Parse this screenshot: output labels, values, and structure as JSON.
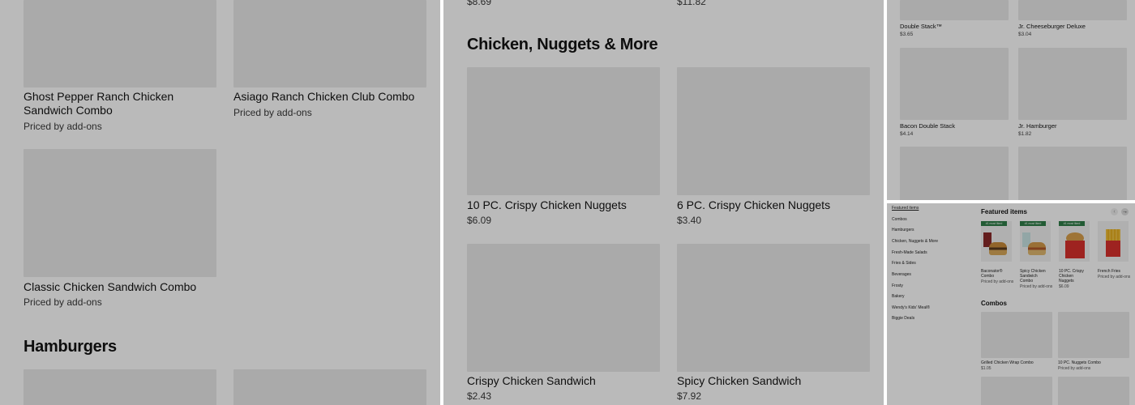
{
  "panel1": {
    "items": [
      {
        "name": "Ghost Pepper Ranch Chicken Sandwich Combo",
        "price": "Priced by add-ons"
      },
      {
        "name": "Asiago Ranch Chicken Club Combo",
        "price": "Priced by add-ons"
      },
      {
        "name": "Classic Chicken Sandwich Combo",
        "price": "Priced by add-ons"
      }
    ],
    "section_heading": "Hamburgers"
  },
  "panel2": {
    "top_prices": [
      "$8.69",
      "$11.82"
    ],
    "section_heading": "Chicken, Nuggets & More",
    "items": [
      {
        "name": "10 PC. Crispy Chicken Nuggets",
        "price": "$6.09"
      },
      {
        "name": "6 PC. Crispy Chicken Nuggets",
        "price": "$3.40"
      },
      {
        "name": "Crispy Chicken Sandwich",
        "price": "$2.43"
      },
      {
        "name": "Spicy Chicken Sandwich",
        "price": "$7.92"
      }
    ]
  },
  "panel3": {
    "items": [
      {
        "name": "Double Stack™",
        "price": "$3.65"
      },
      {
        "name": "Jr. Cheeseburger Deluxe",
        "price": "$3.04"
      },
      {
        "name": "Bacon Double Stack",
        "price": "$4.14"
      },
      {
        "name": "Jr. Hamburger",
        "price": "$1.82"
      }
    ]
  },
  "panel4": {
    "sidebar": [
      "Featured items",
      "Combos",
      "Hamburgers",
      "Chicken, Nuggets & More",
      "Fresh-Made Salads",
      "Fries & Sides",
      "Beverages",
      "Frosty",
      "Bakery",
      "Wendy's Kids' Meal®",
      "Biggie Deals"
    ],
    "featured_heading": "Featured items",
    "badge": "#1 most liked",
    "featured": [
      {
        "name": "Baconator® Combo",
        "price": "Priced by add-ons"
      },
      {
        "name": "Spicy Chicken Sandwich Combo",
        "price": "Priced by add-ons"
      },
      {
        "name": "10 PC. Crispy Chicken Nuggets",
        "price": "$6.09"
      },
      {
        "name": "French Fries",
        "price": "Priced by add-ons"
      }
    ],
    "combos_heading": "Combos",
    "combos": [
      {
        "name": "Grilled Chicken Wrap Combo",
        "price": "$1.05"
      },
      {
        "name": "10 PC. Nuggets Combo",
        "price": "Priced by add-ons"
      }
    ],
    "nav_prev_icon": "chevron-left-icon",
    "nav_next_icon": "arrow-right-icon"
  }
}
